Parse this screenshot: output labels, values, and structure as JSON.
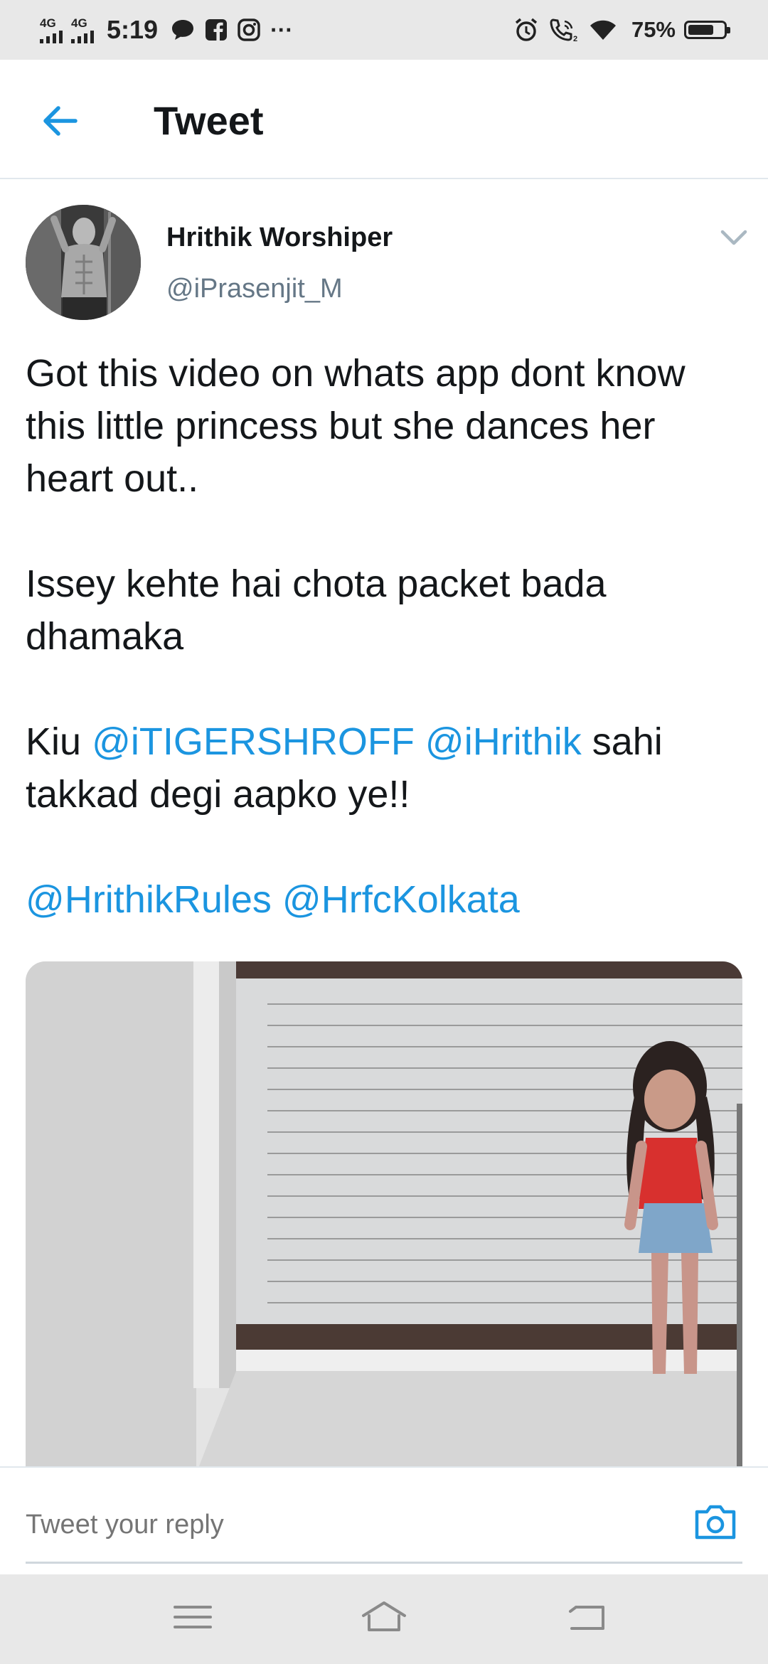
{
  "status_bar": {
    "network1": "4G",
    "network2": "4G",
    "time": "5:19",
    "more": "···",
    "battery_percent": "75%",
    "battery_level": 0.75,
    "icons": [
      "chat-bubble-icon",
      "facebook-icon",
      "instagram-icon",
      "alarm-icon",
      "wifi-call-icon",
      "wifi-icon",
      "battery-icon"
    ]
  },
  "header": {
    "title": "Tweet",
    "back_icon": "arrow-left-icon"
  },
  "tweet": {
    "display_name": "Hrithik Worshiper",
    "handle": "@iPrasenjit_M",
    "more_icon": "chevron-down-icon",
    "para1": "Got this video on whats app dont know this little princess but she dances her heart out..",
    "para2": "Issey kehte hai chota packet bada dhamaka",
    "para3_prefix": "Kiu ",
    "mention1": "@iTIGERSHROFF",
    "mention2": "@iHrithik",
    "para3_suffix": " sahi takkad degi aapko ye!!",
    "mention3": "@HrithikRules",
    "mention4": "@HrfcKolkata"
  },
  "reply": {
    "placeholder": "Tweet your reply",
    "camera_icon": "camera-icon"
  },
  "nav": {
    "icons": [
      "menu-icon",
      "home-icon",
      "back-icon"
    ]
  },
  "colors": {
    "accent": "#1b95e0",
    "text": "#14171a",
    "secondary": "#657786",
    "divider": "#e1e8ed"
  }
}
